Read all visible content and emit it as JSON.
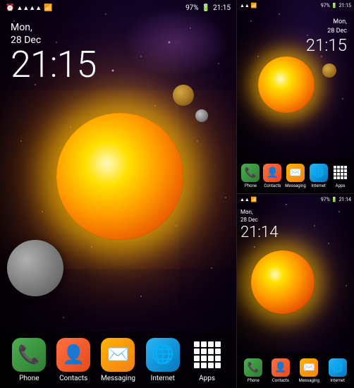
{
  "leftPanel": {
    "statusBar": {
      "icons": "alarm signal wifi battery",
      "batteryPercent": "97%",
      "time": "21:15"
    },
    "clock": {
      "date": "Mon,\n28 Dec",
      "time": "21:15"
    },
    "dock": {
      "items": [
        {
          "id": "phone",
          "label": "Phone",
          "emoji": "📞",
          "class": "phone"
        },
        {
          "id": "contacts",
          "label": "Contacts",
          "emoji": "👤",
          "class": "contacts"
        },
        {
          "id": "messaging",
          "label": "Messaging",
          "emoji": "✉️",
          "class": "messaging"
        },
        {
          "id": "internet",
          "label": "Internet",
          "emoji": "🌐",
          "class": "internet"
        },
        {
          "id": "apps",
          "label": "Apps",
          "emoji": "",
          "class": "apps"
        }
      ]
    }
  },
  "rightTopPanel": {
    "statusBar": {
      "batteryPercent": "97%",
      "time": "21:15"
    },
    "clock": {
      "date": "Mon,\n28 Dec",
      "time": "21:15"
    },
    "dock": {
      "items": [
        {
          "id": "phone",
          "label": "Phone",
          "emoji": "📞",
          "class": "phone"
        },
        {
          "id": "contacts",
          "label": "Contacts",
          "emoji": "👤",
          "class": "contacts"
        },
        {
          "id": "messaging",
          "label": "Messaging",
          "emoji": "✉️",
          "class": "messaging"
        },
        {
          "id": "internet",
          "label": "Internet",
          "emoji": "🌐",
          "class": "internet"
        },
        {
          "id": "apps",
          "label": "Apps",
          "emoji": "",
          "class": "apps"
        }
      ]
    }
  },
  "rightBottomPanel": {
    "statusBar": {
      "batteryPercent": "97%",
      "time": "21:14"
    },
    "clock": {
      "date": "Mon,\n28 Dec",
      "time": "21:14"
    },
    "dock": {
      "items": [
        {
          "id": "phone",
          "label": "Phone",
          "emoji": "📞",
          "class": "phone"
        },
        {
          "id": "contacts",
          "label": "Contacts",
          "emoji": "👤",
          "class": "contacts"
        },
        {
          "id": "messaging",
          "label": "Messaging",
          "emoji": "✉️",
          "class": "messaging"
        },
        {
          "id": "internet",
          "label": "Internet",
          "emoji": "🌐",
          "class": "internet"
        }
      ]
    }
  }
}
